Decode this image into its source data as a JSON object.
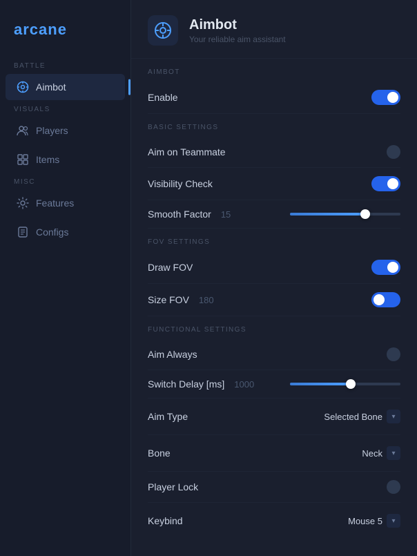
{
  "app": {
    "logo": "arcane"
  },
  "sidebar": {
    "battle_label": "BATTLE",
    "visuals_label": "VISUALS",
    "misc_label": "MISC",
    "items": [
      {
        "id": "aimbot",
        "label": "Aimbot",
        "active": true
      },
      {
        "id": "players",
        "label": "Players",
        "active": false
      },
      {
        "id": "items",
        "label": "Items",
        "active": false
      },
      {
        "id": "features",
        "label": "Features",
        "active": false
      },
      {
        "id": "configs",
        "label": "Configs",
        "active": false
      }
    ]
  },
  "page": {
    "title": "Aimbot",
    "subtitle": "Your reliable aim assistant",
    "section_aimbot": "Aimbot",
    "section_basic": "Basic Settings",
    "section_fov": "FOV Settings",
    "section_functional": "Functional Settings"
  },
  "settings": {
    "enable": {
      "label": "Enable",
      "state": "on"
    },
    "aim_on_teammate": {
      "label": "Aim on Teammate",
      "state": "dot"
    },
    "visibility_check": {
      "label": "Visibility Check",
      "state": "on"
    },
    "smooth_factor": {
      "label": "Smooth Factor",
      "value": "15",
      "fill_pct": 68
    },
    "draw_fov": {
      "label": "Draw FOV",
      "state": "on"
    },
    "size_fov": {
      "label": "Size FOV",
      "value": "180",
      "state": "on-small",
      "fill_pct": 20
    },
    "aim_always": {
      "label": "Aim Always",
      "state": "dot"
    },
    "switch_delay": {
      "label": "Switch Delay [ms]",
      "value": "1000",
      "fill_pct": 55
    },
    "aim_type": {
      "label": "Aim Type",
      "dropdown_value": "Selected Bone"
    },
    "bone": {
      "label": "Bone",
      "dropdown_value": "Neck"
    },
    "player_lock": {
      "label": "Player Lock",
      "state": "dot"
    },
    "keybind": {
      "label": "Keybind",
      "dropdown_value": "Mouse 5"
    }
  }
}
